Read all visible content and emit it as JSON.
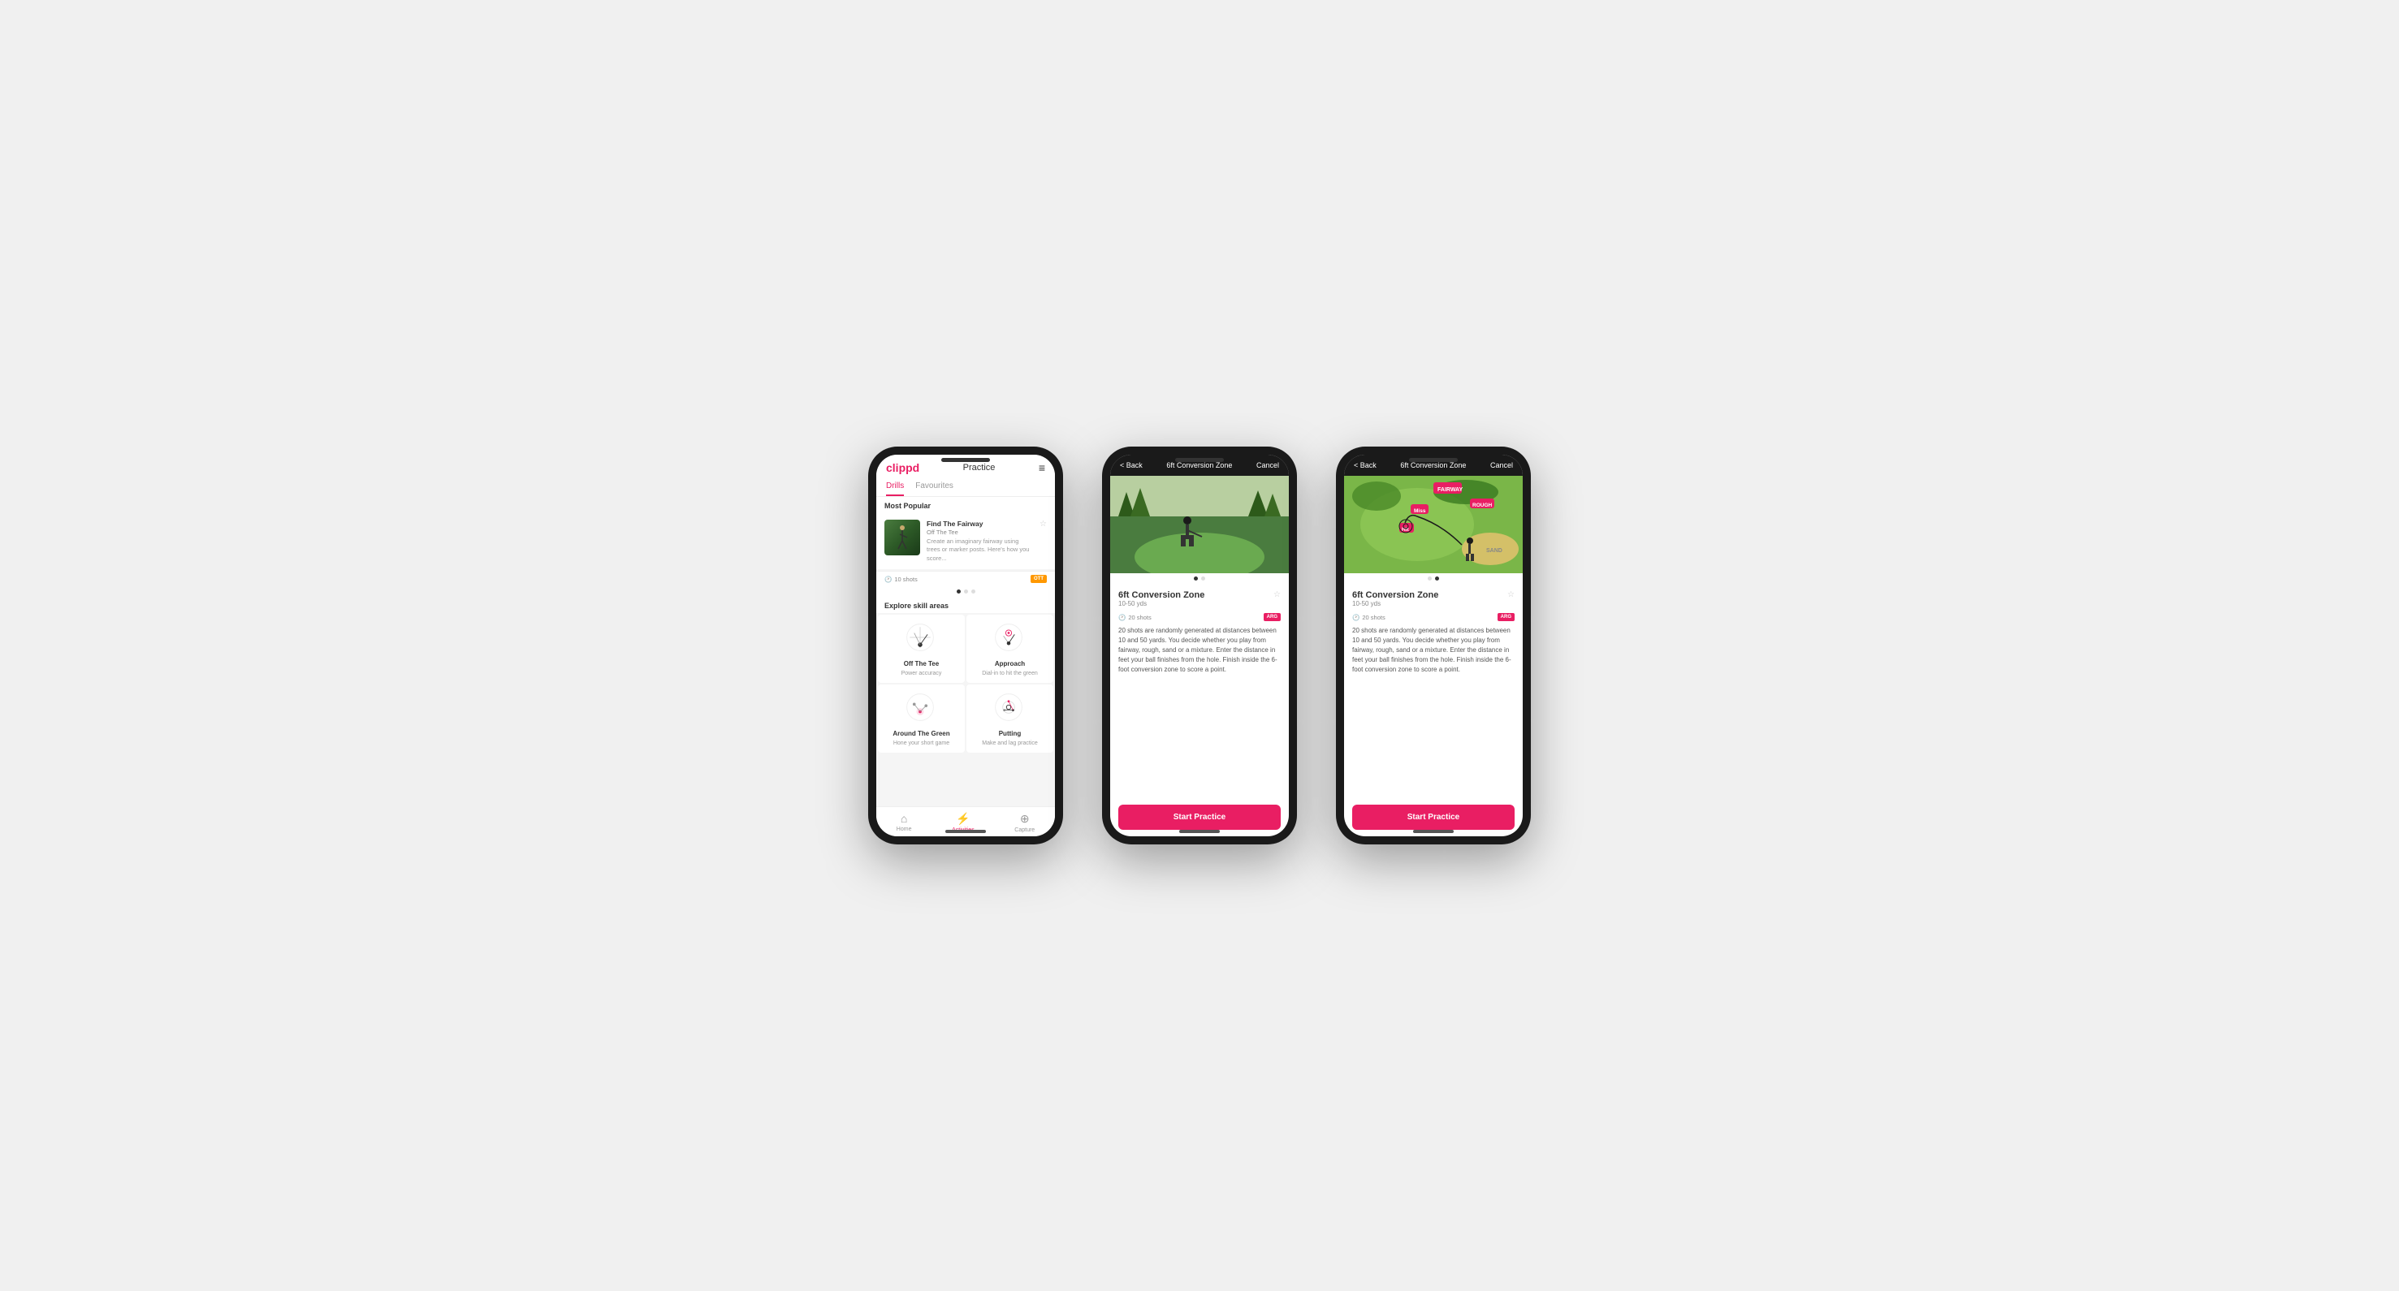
{
  "phone1": {
    "logo": "clippd",
    "header_title": "Practice",
    "menu_icon": "≡",
    "tabs": [
      {
        "label": "Drills",
        "active": true
      },
      {
        "label": "Favourites",
        "active": false
      }
    ],
    "most_popular": "Most Popular",
    "featured_drill": {
      "name": "Find The Fairway",
      "sub": "Off The Tee",
      "desc": "Create an imaginary fairway using trees or marker posts. Here's how you score...",
      "shots": "10 shots",
      "badge": "OTT"
    },
    "dots": [
      "active",
      "inactive",
      "inactive"
    ],
    "explore_title": "Explore skill areas",
    "skills": [
      {
        "name": "Off The Tee",
        "desc": "Power accuracy"
      },
      {
        "name": "Approach",
        "desc": "Dial-in to hit the green"
      },
      {
        "name": "Around The Green",
        "desc": "Hone your short game"
      },
      {
        "name": "Putting",
        "desc": "Make and lag practice"
      }
    ],
    "nav": [
      {
        "label": "Home",
        "icon": "⌂",
        "active": false
      },
      {
        "label": "Activities",
        "icon": "⚡",
        "active": true
      },
      {
        "label": "Capture",
        "icon": "⊕",
        "active": false
      }
    ]
  },
  "phone2": {
    "header": {
      "back": "< Back",
      "title": "6ft Conversion Zone",
      "cancel": "Cancel"
    },
    "dots_image": [
      "active",
      "inactive"
    ],
    "drill": {
      "name": "6ft Conversion Zone",
      "range": "10-50 yds",
      "shots": "20 shots",
      "badge": "ARG",
      "description": "20 shots are randomly generated at distances between 10 and 50 yards. You decide whether you play from fairway, rough, sand or a mixture. Enter the distance in feet your ball finishes from the hole. Finish inside the 6-foot conversion zone to score a point.",
      "fav_icon": "☆"
    },
    "start_btn": "Start Practice"
  },
  "phone3": {
    "header": {
      "back": "< Back",
      "title": "6ft Conversion Zone",
      "cancel": "Cancel"
    },
    "dots_image": [
      "inactive",
      "active"
    ],
    "drill": {
      "name": "6ft Conversion Zone",
      "range": "10-50 yds",
      "shots": "20 shots",
      "badge": "ARG",
      "description": "20 shots are randomly generated at distances between 10 and 50 yards. You decide whether you play from fairway, rough, sand or a mixture. Enter the distance in feet your ball finishes from the hole. Finish inside the 6-foot conversion zone to score a point.",
      "fav_icon": "☆"
    },
    "start_btn": "Start Practice"
  }
}
